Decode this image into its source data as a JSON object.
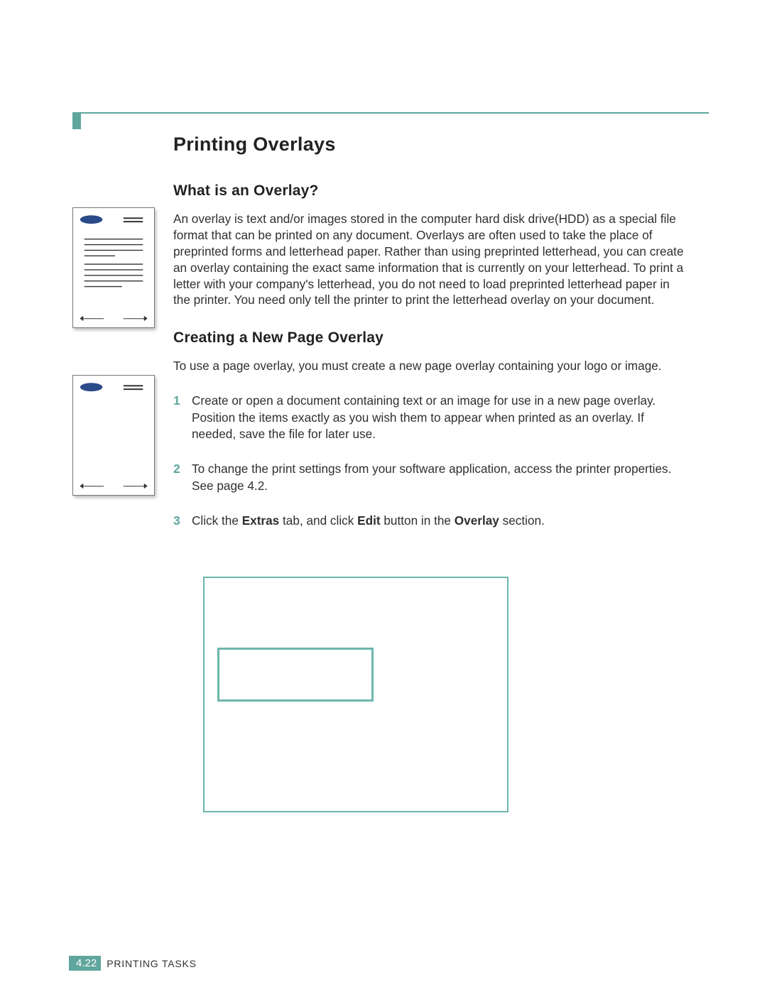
{
  "page": {
    "title": "Printing Overlays",
    "sections": {
      "what": {
        "heading": "What is an Overlay?",
        "body": "An overlay is text and/or images stored in the computer hard disk drive(HDD) as a special file format that can be printed on any document. Overlays are often used to take the place of preprinted forms and letterhead paper. Rather than using preprinted letterhead, you can create an overlay containing the exact same information that is currently on your letterhead. To print a letter with your company's letterhead, you do not need to load preprinted letterhead paper in the printer. You need only tell the printer to print the letterhead overlay on your document."
      },
      "creating": {
        "heading": "Creating a New Page Overlay",
        "intro": "To use a page overlay, you must create a new page overlay containing your logo or image.",
        "steps": {
          "s1": "Create or open a document containing text or an image for use in a new page overlay. Position the items exactly as you wish them to appear when printed as an overlay. If needed, save the file for later use.",
          "s2": "To change the print settings from your software application, access the printer properties. See page 4.2.",
          "s3_a": "Click the ",
          "s3_b1": "Extras",
          "s3_c": " tab, and click ",
          "s3_b2": "Edit",
          "s3_d": " button in the ",
          "s3_b3": "Overlay",
          "s3_e": " section."
        }
      }
    }
  },
  "footer": {
    "chapter": "4.",
    "page": "22",
    "label": "PRINTING TASKS"
  },
  "colors": {
    "accent": "#5fa69d"
  }
}
